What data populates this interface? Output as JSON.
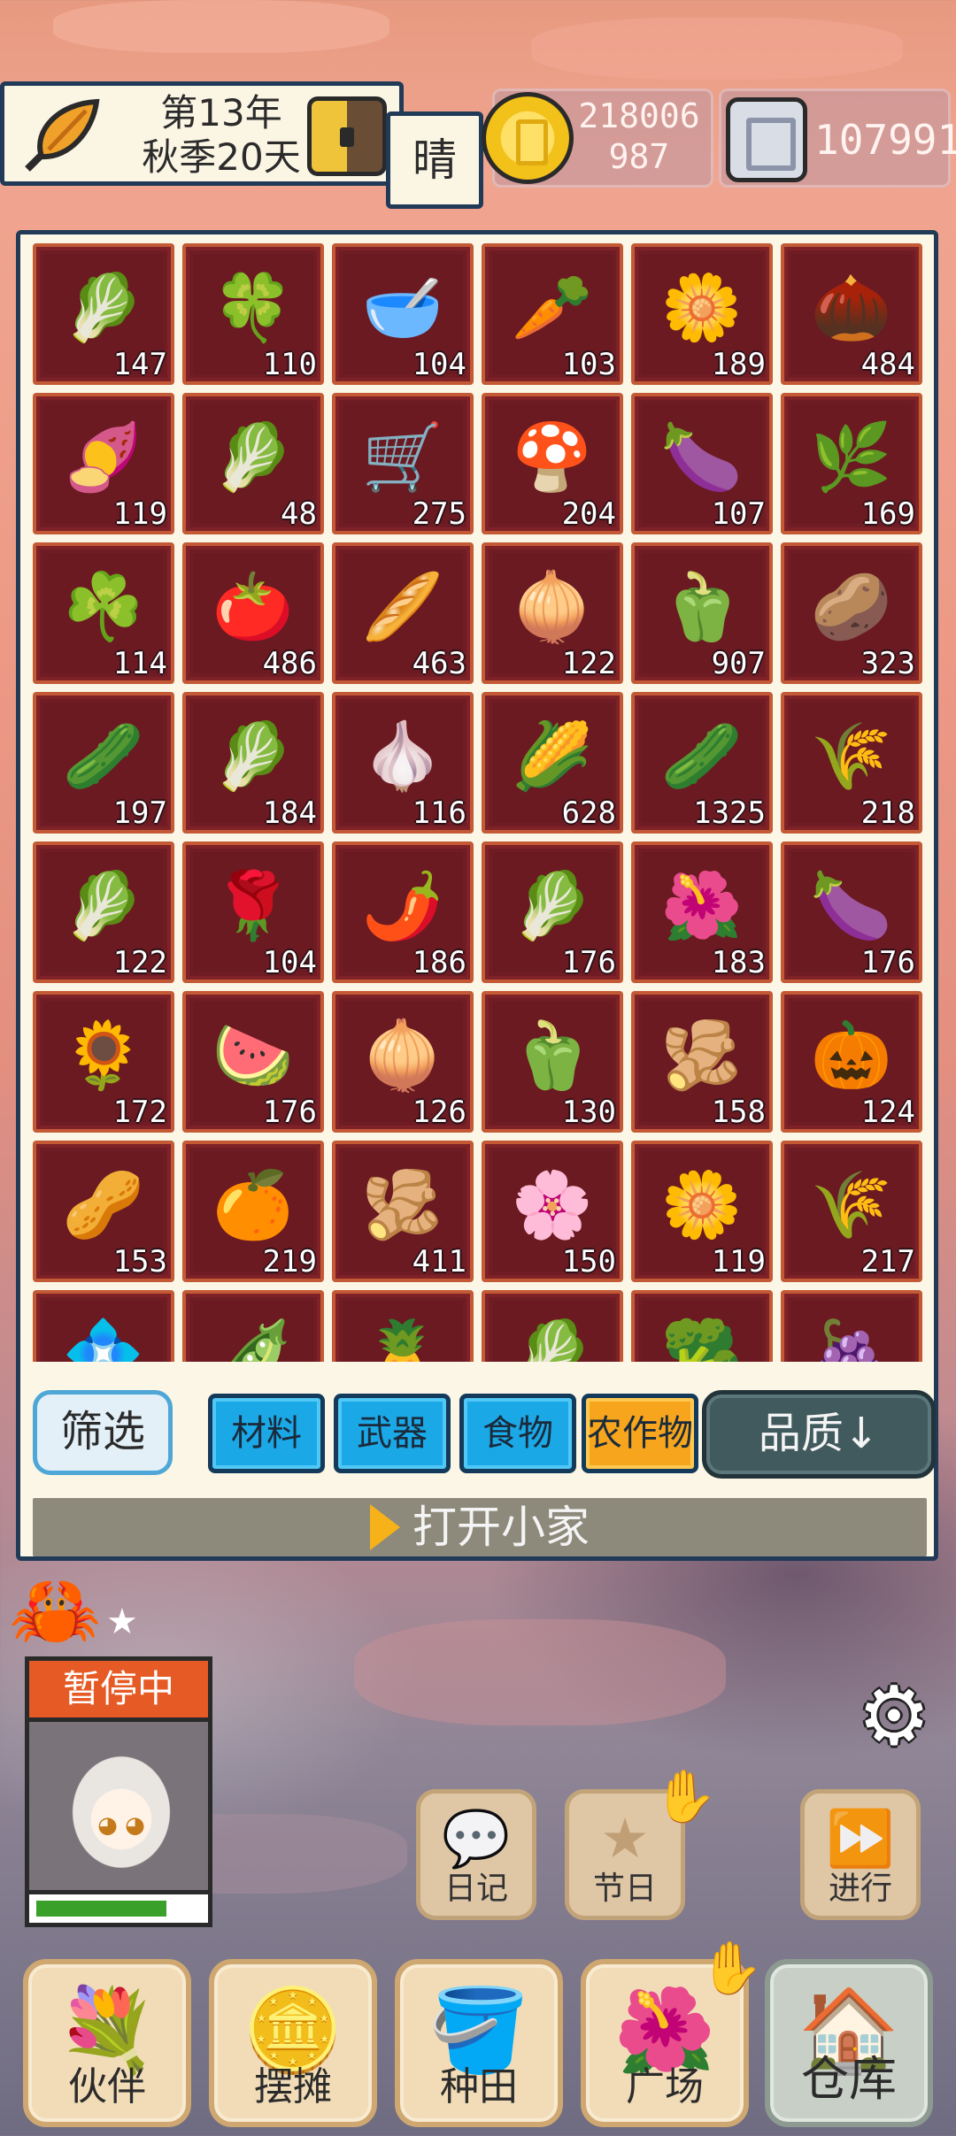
{
  "header": {
    "year": "第13年",
    "season_day": "秋季20天",
    "weather": "晴",
    "coins_line1": "218006",
    "coins_line2": "987",
    "tickets": "107991"
  },
  "inventory": {
    "rows": [
      [
        {
          "icon": "radish",
          "glyph": "🥬",
          "count": "147"
        },
        {
          "icon": "clover",
          "glyph": "🍀",
          "count": "110"
        },
        {
          "icon": "bowl",
          "glyph": "🥣",
          "count": "104"
        },
        {
          "icon": "carrot",
          "glyph": "🥕",
          "count": "103"
        },
        {
          "icon": "lily",
          "glyph": "🌼",
          "count": "189"
        },
        {
          "icon": "seed",
          "glyph": "🌰",
          "count": "484"
        }
      ],
      [
        {
          "icon": "sweet-potato",
          "glyph": "🍠",
          "count": "119"
        },
        {
          "icon": "greens",
          "glyph": "🥬",
          "count": "48"
        },
        {
          "icon": "blue-cart",
          "glyph": "🛒",
          "count": "275"
        },
        {
          "icon": "mushroom",
          "glyph": "🍄",
          "count": "204"
        },
        {
          "icon": "yam",
          "glyph": "🍆",
          "count": "107"
        },
        {
          "icon": "leek",
          "glyph": "🌿",
          "count": "169"
        }
      ],
      [
        {
          "icon": "herb",
          "glyph": "☘️",
          "count": "114"
        },
        {
          "icon": "tomato",
          "glyph": "🍅",
          "count": "486"
        },
        {
          "icon": "bread",
          "glyph": "🥖",
          "count": "463"
        },
        {
          "icon": "beet",
          "glyph": "🧅",
          "count": "122"
        },
        {
          "icon": "red-pepper",
          "glyph": "🫑",
          "count": "907"
        },
        {
          "icon": "potato",
          "glyph": "🥔",
          "count": "323"
        }
      ],
      [
        {
          "icon": "scallion",
          "glyph": "🥒",
          "count": "197"
        },
        {
          "icon": "cabbage",
          "glyph": "🥬",
          "count": "184"
        },
        {
          "icon": "garlic",
          "glyph": "🧄",
          "count": "116"
        },
        {
          "icon": "corn",
          "glyph": "🌽",
          "count": "628"
        },
        {
          "icon": "cucumber",
          "glyph": "🥒",
          "count": "1325"
        },
        {
          "icon": "wheat",
          "glyph": "🌾",
          "count": "218"
        }
      ],
      [
        {
          "icon": "turnip",
          "glyph": "🥬",
          "count": "122"
        },
        {
          "icon": "rose",
          "glyph": "🌹",
          "count": "104"
        },
        {
          "icon": "chili",
          "glyph": "🌶️",
          "count": "186"
        },
        {
          "icon": "lettuce",
          "glyph": "🥬",
          "count": "176"
        },
        {
          "icon": "hibiscus",
          "glyph": "🌺",
          "count": "183"
        },
        {
          "icon": "eggplant",
          "glyph": "🍆",
          "count": "176"
        }
      ],
      [
        {
          "icon": "sunflower",
          "glyph": "🌻",
          "count": "172"
        },
        {
          "icon": "watermelon",
          "glyph": "🍉",
          "count": "176"
        },
        {
          "icon": "white-turnip",
          "glyph": "🧅",
          "count": "126"
        },
        {
          "icon": "green-pepper",
          "glyph": "🫑",
          "count": "130"
        },
        {
          "icon": "ginger",
          "glyph": "🫚",
          "count": "158"
        },
        {
          "icon": "pumpkin",
          "glyph": "🎃",
          "count": "124"
        }
      ],
      [
        {
          "icon": "peanut",
          "glyph": "🥜",
          "count": "153"
        },
        {
          "icon": "orange",
          "glyph": "🍊",
          "count": "219"
        },
        {
          "icon": "root",
          "glyph": "🫚",
          "count": "411"
        },
        {
          "icon": "pink-flower",
          "glyph": "🌸",
          "count": "150"
        },
        {
          "icon": "daisy",
          "glyph": "🌼",
          "count": "119"
        },
        {
          "icon": "lavender",
          "glyph": "🌾",
          "count": "217"
        }
      ],
      [
        {
          "icon": "blue-flower",
          "glyph": "💠",
          "count": ""
        },
        {
          "icon": "green-bulb",
          "glyph": "🫛",
          "count": ""
        },
        {
          "icon": "pineapple",
          "glyph": "🍍",
          "count": ""
        },
        {
          "icon": "blue-cabbage",
          "glyph": "🥬",
          "count": ""
        },
        {
          "icon": "cauliflower",
          "glyph": "🥦",
          "count": ""
        },
        {
          "icon": "mangosteen",
          "glyph": "🍇",
          "count": ""
        }
      ]
    ]
  },
  "filters": {
    "filter_label": "筛选",
    "categories": [
      "材料",
      "武器",
      "食物",
      "农作物"
    ],
    "active_category": "农作物",
    "sort_label": "品质↓"
  },
  "open_home_label": "打开小家",
  "companion": {
    "status": "暂停中",
    "stamina_fraction": 0.78
  },
  "side_buttons": {
    "diary": "日记",
    "festival": "节日",
    "proceed": "进行"
  },
  "bottom_nav": {
    "partner": "伙伴",
    "stall": "摆摊",
    "farm": "种田",
    "square": "广场",
    "warehouse": "仓库"
  },
  "colors": {
    "slot_bg": "#6b1a22",
    "slot_border": "#c45a35",
    "category_btn": "#1ba8e6",
    "active_category_btn": "#f7a51c",
    "paused_label": "#e65a25"
  }
}
